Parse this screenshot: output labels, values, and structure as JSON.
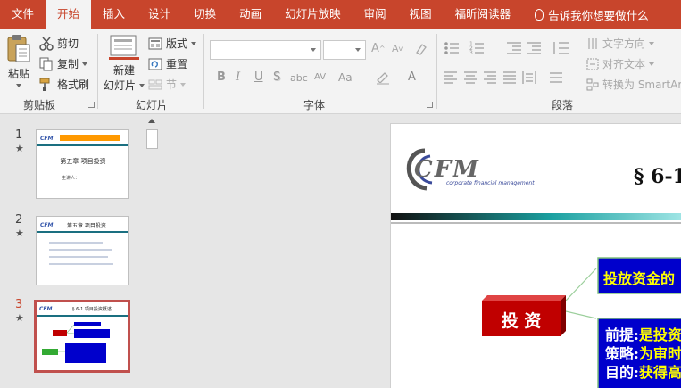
{
  "tabs": [
    {
      "label": "文件",
      "active": false
    },
    {
      "label": "开始",
      "active": true
    },
    {
      "label": "插入",
      "active": false
    },
    {
      "label": "设计",
      "active": false
    },
    {
      "label": "切换",
      "active": false
    },
    {
      "label": "动画",
      "active": false
    },
    {
      "label": "幻灯片放映",
      "active": false
    },
    {
      "label": "审阅",
      "active": false
    },
    {
      "label": "视图",
      "active": false
    },
    {
      "label": "福昕阅读器",
      "active": false
    }
  ],
  "tell_me": "告诉我你想要做什么",
  "clipboard": {
    "paste": "粘贴",
    "cut": "剪切",
    "copy": "复制",
    "format_painter": "格式刷",
    "group": "剪贴板"
  },
  "slides_group": {
    "new_slide_1": "新建",
    "new_slide_2": "幻灯片",
    "layout": "版式",
    "reset": "重置",
    "section": "节",
    "group": "幻灯片"
  },
  "font_group": {
    "group": "字体",
    "bold": "B",
    "italic": "I",
    "underline": "U",
    "shadow": "S",
    "strike": "abc",
    "spacing": "AV",
    "case": "Aa",
    "color": "A",
    "grow": "A",
    "shrink": "A"
  },
  "paragraph_group": {
    "group": "段落",
    "text_direction": "文字方向",
    "align_text": "对齐文本",
    "smartart": "转换为 SmartArt"
  },
  "thumbnails": [
    {
      "number": "1",
      "star": "★",
      "title": "第五章 项目投资",
      "sub": "主讲人：",
      "selected": false
    },
    {
      "number": "2",
      "star": "★",
      "title": "第五章 项目投资",
      "selected": false
    },
    {
      "number": "3",
      "star": "★",
      "title": "§ 6-1 项目投资概述",
      "selected": true
    }
  ],
  "slide": {
    "logo": "CFM",
    "logo_sub": "corporate financial management",
    "section": "§ 6-1",
    "node_main": "投 资",
    "node_top": "投放资金的",
    "lines": [
      {
        "label": "前提:",
        "text": "是投资"
      },
      {
        "label": "策略:",
        "text": "为审时"
      },
      {
        "label": "目的:",
        "text": "获得高"
      }
    ]
  },
  "colors": {
    "accent": "#c8452c",
    "ribbon": "#f3f3f3",
    "pane": "#e6e6e6",
    "node_red": "#c00000",
    "node_blue": "#0000cc",
    "node_text_yellow": "#ffff00"
  }
}
